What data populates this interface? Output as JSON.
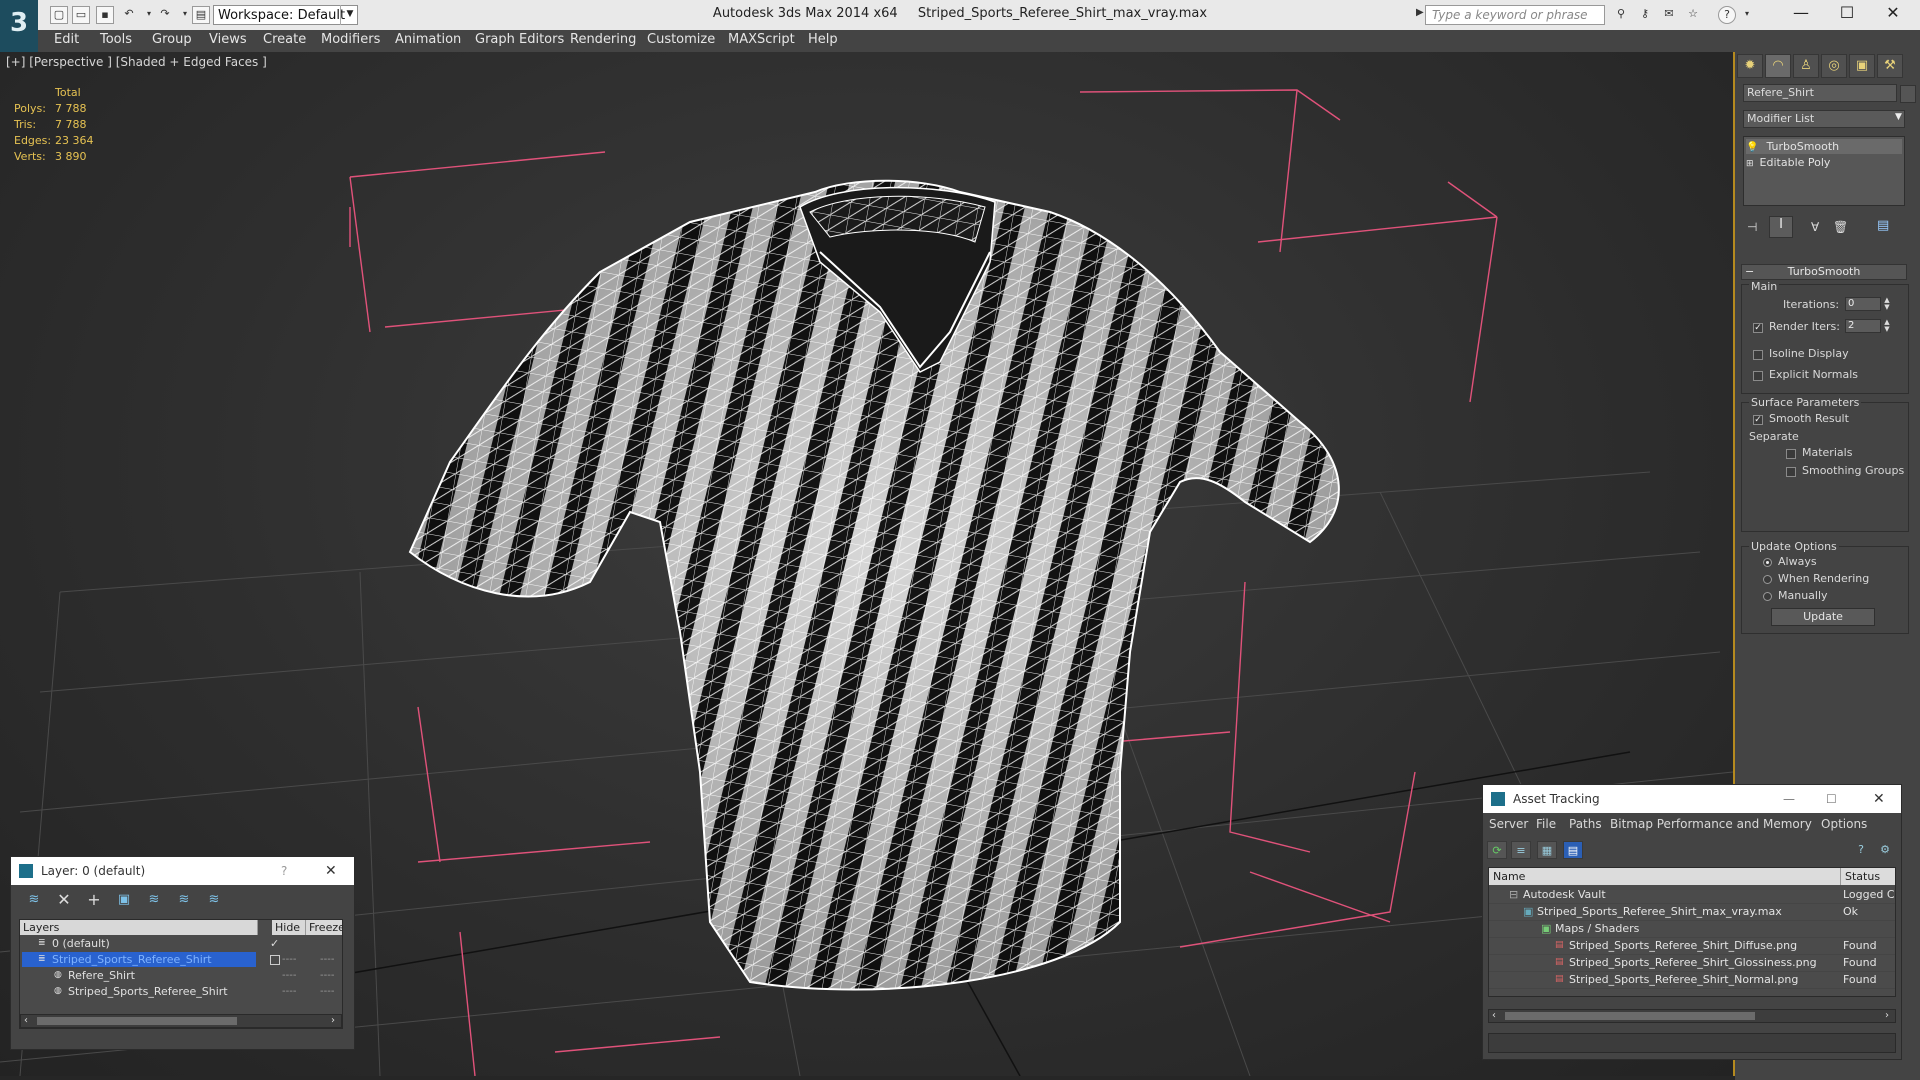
{
  "titlebar": {
    "app": "Autodesk 3ds Max  2014 x64",
    "file": "Striped_Sports_Referee_Shirt_max_vray.max",
    "workspace": "Workspace: Default",
    "search_placeholder": "Type a keyword or phrase"
  },
  "menu": [
    "Edit",
    "Tools",
    "Group",
    "Views",
    "Create",
    "Modifiers",
    "Animation",
    "Graph Editors",
    "Rendering",
    "Customize",
    "MAXScript",
    "Help"
  ],
  "viewport": {
    "label": "[+] [Perspective ] [Shaded + Edged Faces ]",
    "stats": {
      "header": "Total",
      "polys_label": "Polys:",
      "polys": "7 788",
      "tris_label": "Tris:",
      "tris": "7 788",
      "edges_label": "Edges:",
      "edges": "23 364",
      "verts_label": "Verts:",
      "verts": "3 890"
    },
    "colors": {
      "bbox": "#e0527a",
      "wire": "#ffffff",
      "stripe_dark": "#151515"
    }
  },
  "command_panel": {
    "object_name": "Refere_Shirt",
    "modifier_list": "Modifier List",
    "stack": [
      "TurboSmooth",
      "Editable Poly"
    ],
    "turbosmooth": {
      "title": "TurboSmooth",
      "main": "Main",
      "iterations_label": "Iterations:",
      "iterations": "0",
      "render_iters_label": "Render Iters:",
      "render_iters": "2",
      "isoline": "Isoline Display",
      "explicit": "Explicit Normals",
      "surface": "Surface Parameters",
      "smooth_result": "Smooth Result",
      "separate": "Separate",
      "materials": "Materials",
      "smoothing_groups": "Smoothing Groups",
      "update_options": "Update Options",
      "always": "Always",
      "when_rendering": "When Rendering",
      "manually": "Manually",
      "update": "Update"
    }
  },
  "layer_dialog": {
    "title": "Layer: 0 (default)",
    "help": "?",
    "col_layers": "Layers",
    "col_hide": "Hide",
    "col_freeze": "Freeze",
    "rows": [
      "0 (default)",
      "Striped_Sports_Referee_Shirt",
      "Refere_Shirt",
      "Striped_Sports_Referee_Shirt"
    ]
  },
  "asset_dialog": {
    "title": "Asset Tracking",
    "menu": [
      "Server",
      "File",
      "Paths",
      "Bitmap Performance and Memory",
      "Options"
    ],
    "col_name": "Name",
    "col_status": "Status",
    "rows": [
      {
        "name": "Autodesk Vault",
        "status": "Logged C"
      },
      {
        "name": "Striped_Sports_Referee_Shirt_max_vray.max",
        "status": "Ok"
      },
      {
        "name": "Maps / Shaders",
        "status": ""
      },
      {
        "name": "Striped_Sports_Referee_Shirt_Diffuse.png",
        "status": "Found"
      },
      {
        "name": "Striped_Sports_Referee_Shirt_Glossiness.png",
        "status": "Found"
      },
      {
        "name": "Striped_Sports_Referee_Shirt_Normal.png",
        "status": "Found"
      }
    ]
  }
}
